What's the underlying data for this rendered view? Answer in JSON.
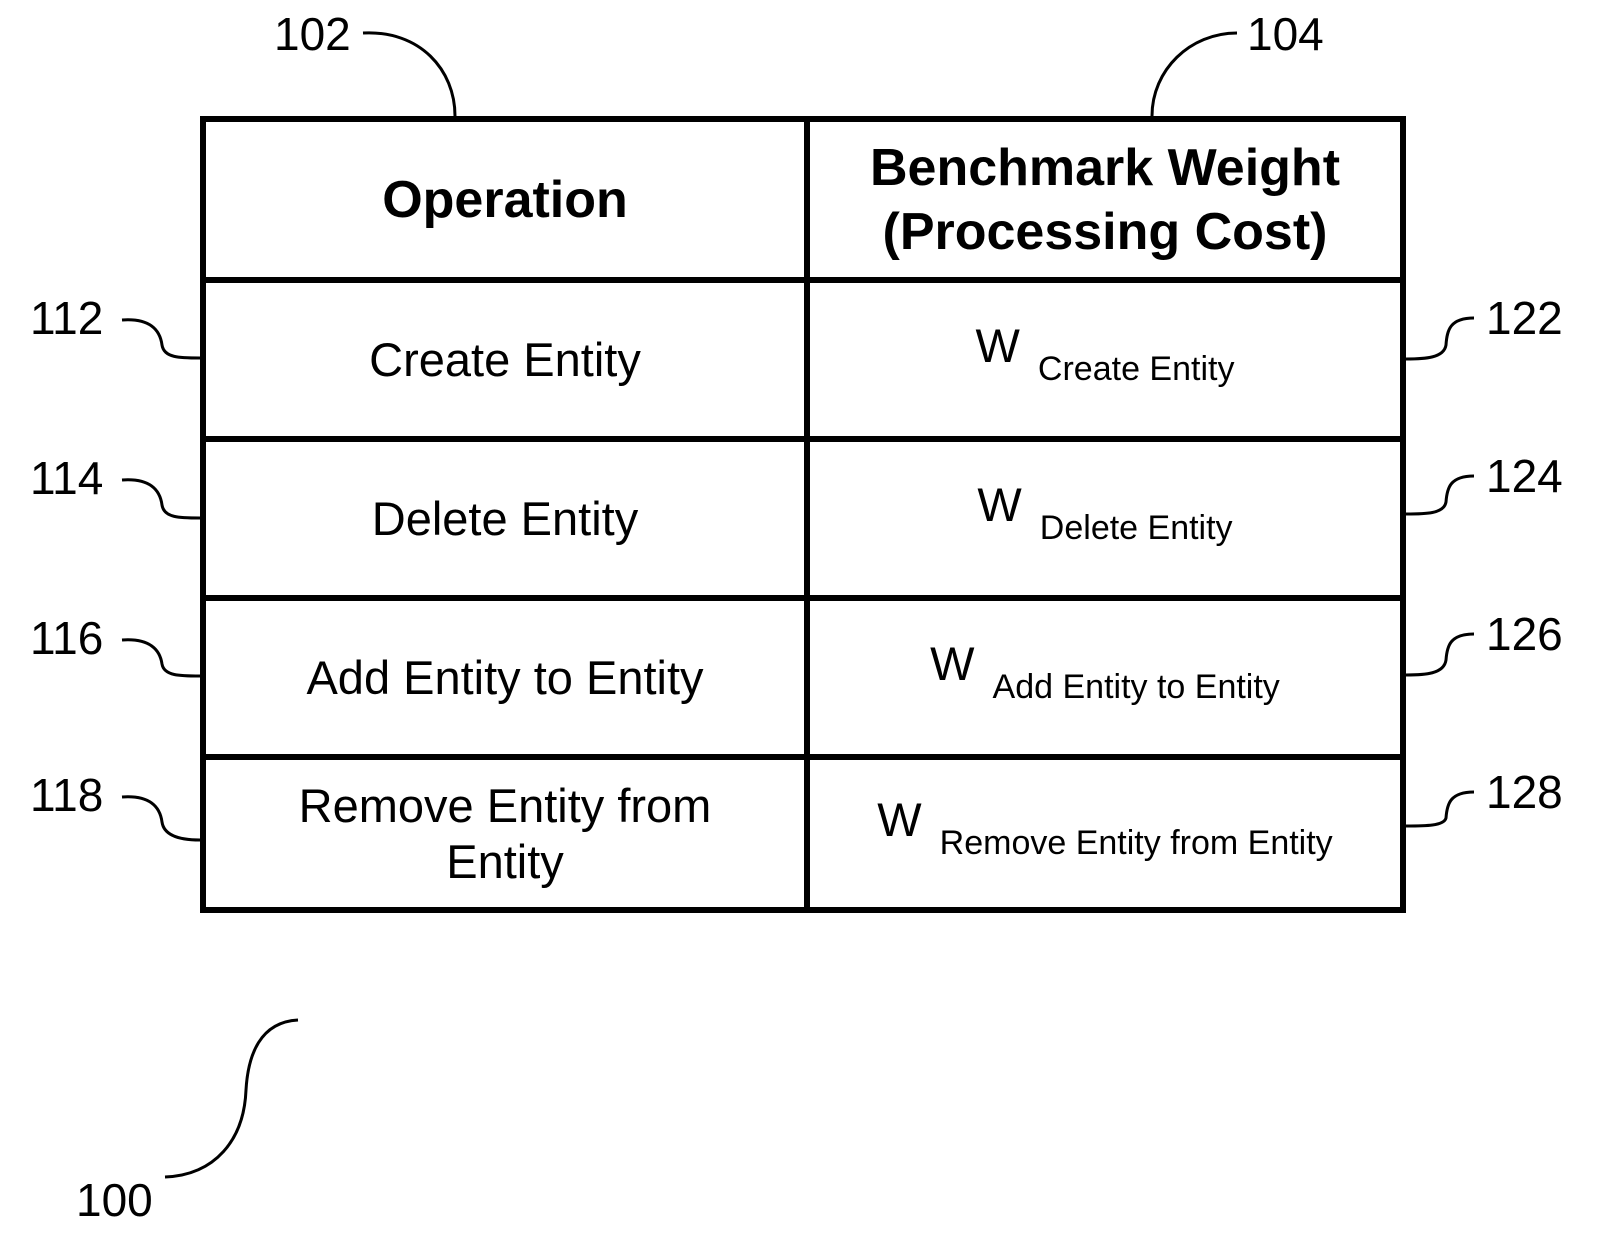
{
  "figure": {
    "figure_ref": "100",
    "header": {
      "operation": "Operation",
      "weight_line1": "Benchmark Weight",
      "weight_line2": "(Processing Cost)",
      "operation_ref": "102",
      "weight_ref": "104"
    },
    "rows": [
      {
        "operation": "Create Entity",
        "weight_symbol": "W",
        "weight_subscript": "Create Entity",
        "operation_ref": "112",
        "weight_ref": "122"
      },
      {
        "operation": "Delete Entity",
        "weight_symbol": "W",
        "weight_subscript": "Delete Entity",
        "operation_ref": "114",
        "weight_ref": "124"
      },
      {
        "operation": "Add Entity to Entity",
        "weight_symbol": "W",
        "weight_subscript": "Add Entity to Entity",
        "operation_ref": "116",
        "weight_ref": "126"
      },
      {
        "operation_line1": "Remove Entity from",
        "operation_line2": "Entity",
        "weight_symbol": "W",
        "weight_subscript": "Remove Entity from Entity",
        "operation_ref": "118",
        "weight_ref": "128"
      }
    ]
  }
}
